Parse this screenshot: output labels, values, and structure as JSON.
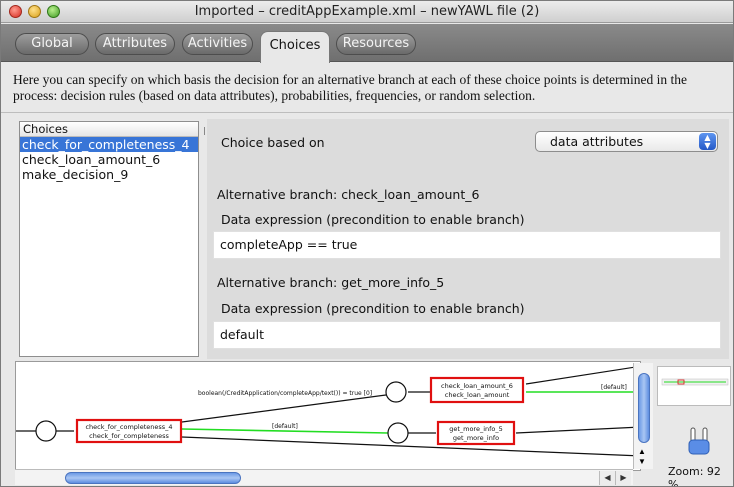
{
  "window": {
    "title": "Imported – creditAppExample.xml – newYAWL file (2)"
  },
  "tabs": [
    {
      "label": "Global"
    },
    {
      "label": "Attributes"
    },
    {
      "label": "Activities"
    },
    {
      "label": "Choices",
      "active": true
    },
    {
      "label": "Resources"
    }
  ],
  "description": "Here you can specify on which basis the decision for an alternative branch at each of these choice points is determined in the process: decision rules (based on data attributes), probabilities, frequencies, or random selection.",
  "choices_list": {
    "header": "Choices",
    "items": [
      {
        "label": "check_for_completeness_4",
        "selected": true
      },
      {
        "label": "check_loan_amount_6"
      },
      {
        "label": "make_decision_9"
      }
    ]
  },
  "detail": {
    "choice_based_on_label": "Choice based on",
    "choice_based_on_value": "data attributes",
    "branches": [
      {
        "title": "Alternative branch:  check_loan_amount_6",
        "expr_label": "Data expression (precondition to enable branch)",
        "expr_value": "completeApp == true"
      },
      {
        "title": "Alternative branch:  get_more_info_5",
        "expr_label": "Data expression (precondition to enable branch)",
        "expr_value": "default"
      }
    ]
  },
  "diagram": {
    "tasks": [
      {
        "line1": "check_for_completeness_4",
        "line2": "check_for_completeness"
      },
      {
        "line1": "check_loan_amount_6",
        "line2": "check_loan_amount"
      },
      {
        "line1": "get_more_info_5",
        "line2": "get_more_info"
      }
    ],
    "edge_labels": {
      "condition": "boolean(/CreditApplication/completeApp/text()) = true [0]",
      "default_1": "[default]",
      "default_2": "[default]"
    },
    "colors": {
      "task_border": "#e01010",
      "default_flow": "#22dd22",
      "flow": "#111111"
    }
  },
  "zoom": {
    "label": "Zoom: 92 %",
    "value": 92
  }
}
